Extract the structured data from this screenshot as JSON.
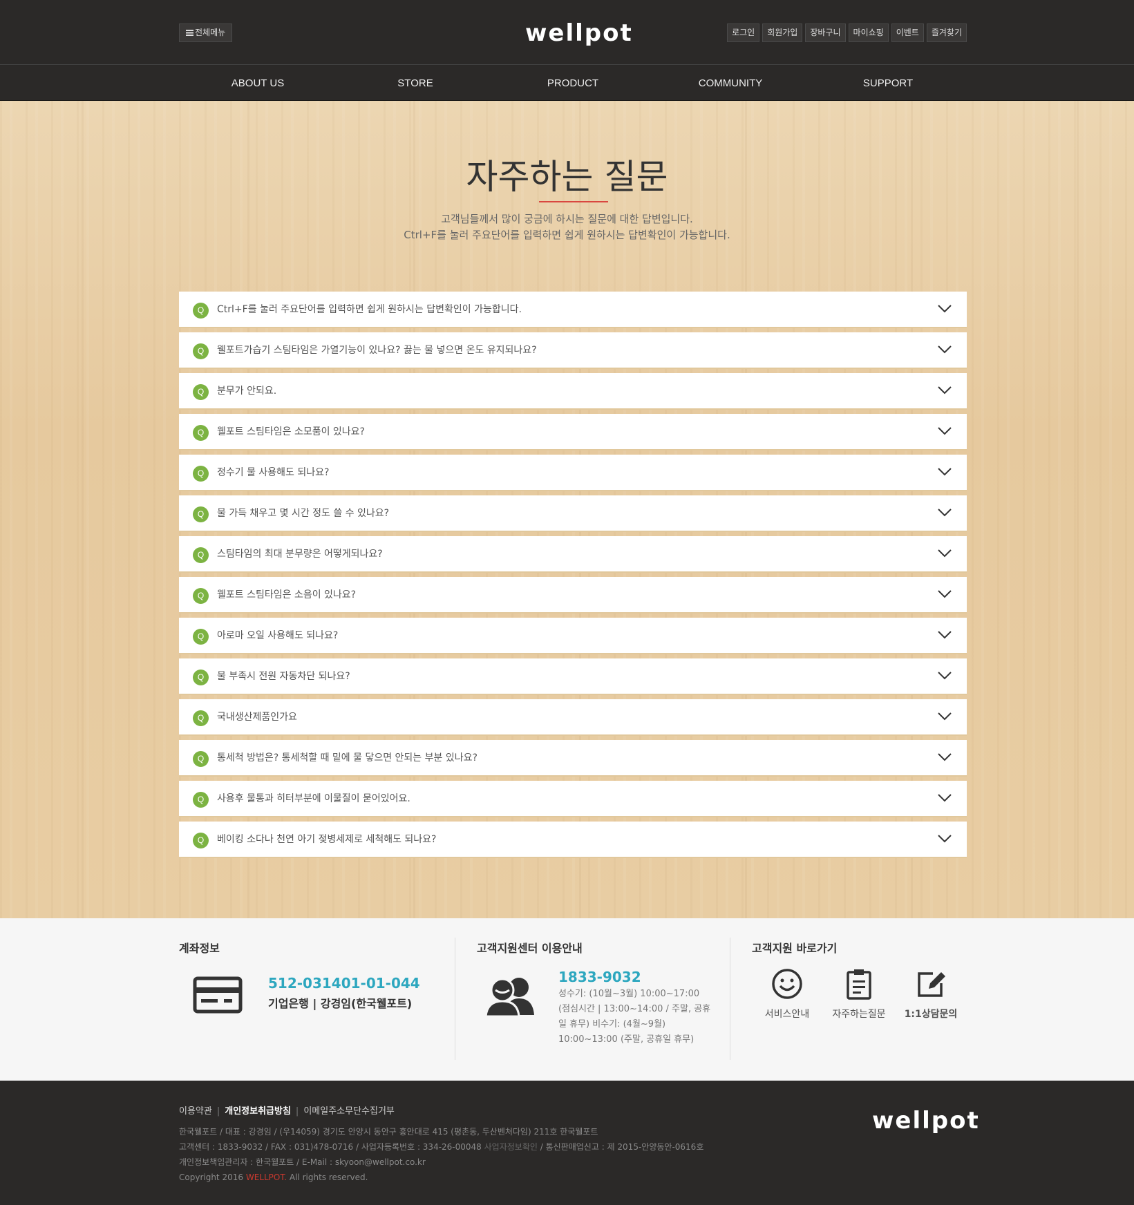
{
  "header": {
    "all_menu_label": "전체메뉴",
    "logo": "wellpot",
    "util_links": [
      "로그인",
      "회원가입",
      "장바구니",
      "마이쇼핑",
      "이벤트",
      "즐겨찾기"
    ]
  },
  "nav": [
    "ABOUT US",
    "STORE",
    "PRODUCT",
    "COMMUNITY",
    "SUPPORT"
  ],
  "page": {
    "title": "자주하는 질문",
    "desc_line1": "고객님들께서 많이 궁금에 하시는 질문에 대한 답변입니다.",
    "desc_line2": "Ctrl+F를 눌러 주요단어를 입력하면 쉽게 원하시는 답변확인이 가능합니다."
  },
  "faq": {
    "badge": "Q",
    "items": [
      "Ctrl+F를 눌러 주요단어를 입력하면 쉽게 원하시는 답변확인이 가능합니다.",
      "웰포트가습기 스팀타임은 가열기능이 있나요? 끓는 물 넣으면 온도 유지되나요?",
      "분무가 안되요.",
      "웰포트 스팀타임은 소모품이 있나요?",
      "정수기 물 사용해도 되나요?",
      "물 가득 채우고 몇 시간 정도 쓸 수 있나요?",
      "스팀타임의 최대 분무량은 어떻게되나요?",
      "웰포트 스팀타임은 소음이 있나요?",
      "아로마 오일 사용해도 되나요?",
      "물 부족시 전원 자동차단 되나요?",
      "국내생산제품인가요",
      "통세척 방법은? 통세척할 때 밑에 물 닿으면 안되는 부분 있나요?",
      "사용후 물통과 히터부분에 이물질이 묻어있어요.",
      "베이킹 소다나 천연 아기 젖병세제로 세척해도 되나요?"
    ]
  },
  "account": {
    "heading": "계좌정보",
    "number": "512-031401-01-044",
    "bank": "기업은행 | 강경임(한국웰포트)"
  },
  "cs": {
    "heading": "고객지원센터 이용안내",
    "phone": "1833-9032",
    "hours": "성수기: (10월~3월) 10:00~17:00 (점심시간 | 13:00~14:00 / 주말, 공휴일 휴무) 비수기: (4월~9월) 10:00~13:00 (주말, 공휴일 휴무)"
  },
  "shortcuts": {
    "heading": "고객지원 바로가기",
    "items": [
      "서비스안내",
      "자주하는질문",
      "1:1상담문의"
    ]
  },
  "footer": {
    "links": [
      "이용약관",
      "개인정보취급방침",
      "이메일주소무단수집거부"
    ],
    "addr1": "한국웰포트  /  대표 : 강경임  /  (우14059) 경기도 안양시 동안구 흥안대로 415 (평촌동, 두산벤처다임) 211호 한국웰포트",
    "addr2_a": "고객센터 : 1833-9032  /  FAX : 031)478-0716  /  사업자등록번호 : 334-26-00048",
    "addr2_b": "사업자정보확인",
    "addr2_c": "/  통신판매업신고 : 제 2015-안양동안-0616호",
    "addr3": "개인정보책임관리자 : 한국웰포트  /  E-Mail : skyoon@wellpot.co.kr",
    "copy_a": "Copyright 2016",
    "copy_b": "WELLPOT.",
    "copy_c": "All rights reserved.",
    "logo": "wellpot"
  },
  "colors": {
    "accent_blue": "#2da7bf",
    "q_green": "#7cb342",
    "title_red": "#d9473f",
    "dark": "#2b2928"
  }
}
